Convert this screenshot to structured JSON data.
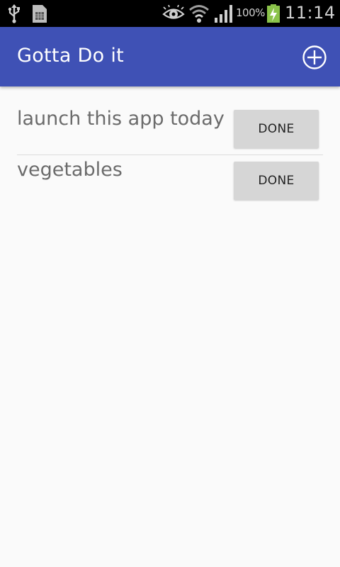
{
  "status_bar": {
    "battery_text": "100%",
    "time": "11:14",
    "icons": [
      "usb-icon",
      "sim-card-icon",
      "eye-icon",
      "wifi-icon",
      "signal-icon",
      "battery-charging-icon"
    ]
  },
  "app_bar": {
    "title": "Gotta Do it",
    "add_icon": "add-circle-icon",
    "color": "#3f51b5"
  },
  "tasks": [
    {
      "text": "launch this app today",
      "button_label": "DONE"
    },
    {
      "text": "vegetables",
      "button_label": "DONE"
    }
  ]
}
